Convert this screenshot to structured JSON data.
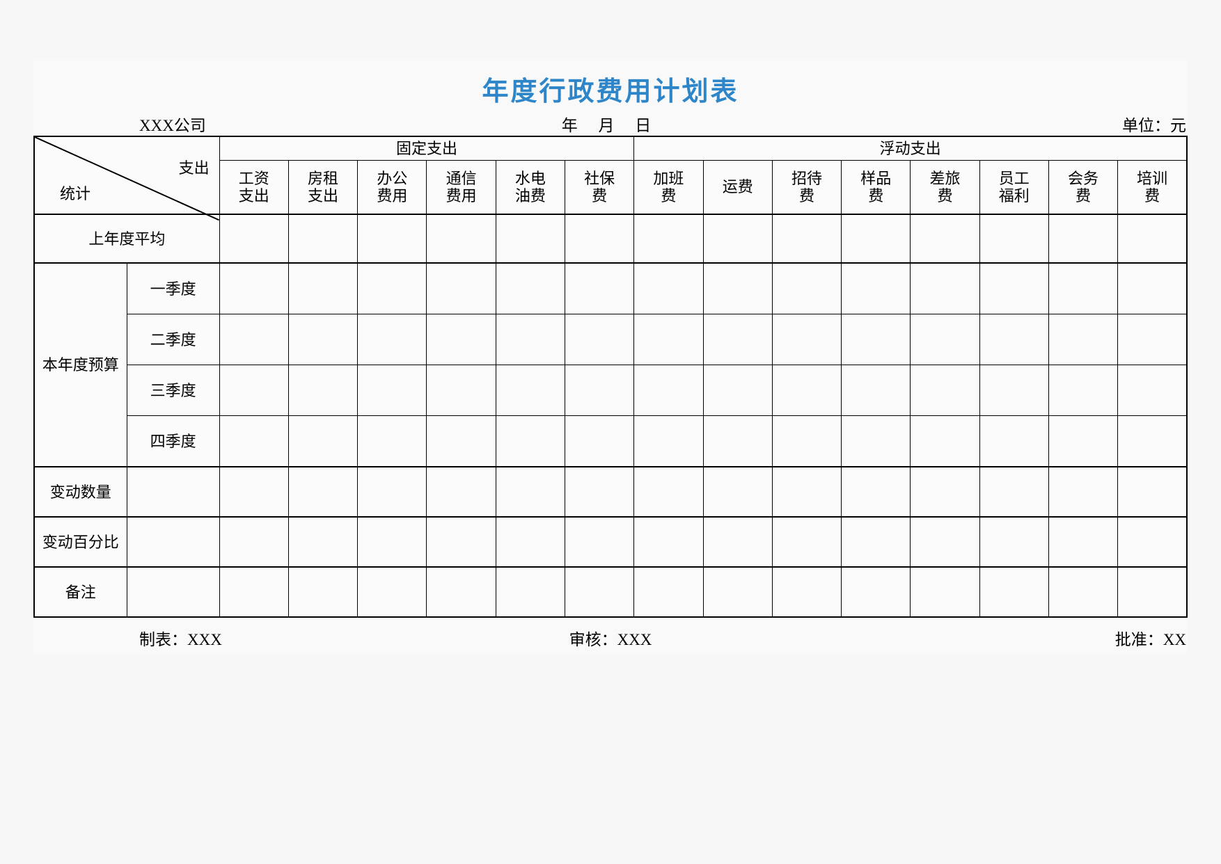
{
  "title": "年度行政费用计划表",
  "subheader": {
    "company": "XXX公司",
    "date": "年  月  日",
    "unit": "单位：元"
  },
  "corner": {
    "top_right_label": "支出",
    "bottom_left_label": "统计"
  },
  "groups": [
    {
      "label": "固定支出",
      "span": 6
    },
    {
      "label": "浮动支出",
      "span": 8
    }
  ],
  "columns": [
    {
      "line1": "工资",
      "line2": "支出"
    },
    {
      "line1": "房租",
      "line2": "支出"
    },
    {
      "line1": "办公",
      "line2": "费用"
    },
    {
      "line1": "通信",
      "line2": "费用"
    },
    {
      "line1": "水电",
      "line2": "油费"
    },
    {
      "line1": "社保",
      "line2": "费"
    },
    {
      "line1": "加班",
      "line2": "费"
    },
    {
      "line1": "运费",
      "line2": ""
    },
    {
      "line1": "招待",
      "line2": "费"
    },
    {
      "line1": "样品",
      "line2": "费"
    },
    {
      "line1": "差旅",
      "line2": "费"
    },
    {
      "line1": "员工",
      "line2": "福利"
    },
    {
      "line1": "会务",
      "line2": "费"
    },
    {
      "line1": "培训",
      "line2": "费"
    }
  ],
  "rows": {
    "prev_year_avg": "上年度平均",
    "budget_group": "本年度预算",
    "quarters": [
      "一季度",
      "二季度",
      "三季度",
      "四季度"
    ],
    "change_amount": "变动数量",
    "change_percent": "变动百分比",
    "remark": "备注"
  },
  "footer": {
    "prepared_by": "制表：XXX",
    "reviewed_by": "审核：XXX",
    "approved_by": "批准：XX"
  },
  "colors": {
    "title": "#2e86c8",
    "grid_line": "#000000",
    "page_background": "#f7f7f7",
    "cell_background": "#fbfbfb"
  }
}
